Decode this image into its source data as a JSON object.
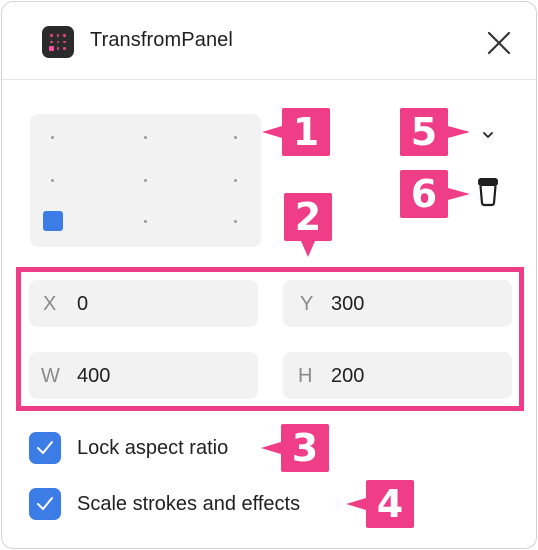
{
  "window": {
    "title": "TransfromPanel"
  },
  "fields": {
    "x": {
      "label": "X",
      "value": "0"
    },
    "y": {
      "label": "Y",
      "value": "300"
    },
    "w": {
      "label": "W",
      "value": "400"
    },
    "h": {
      "label": "H",
      "value": "200"
    }
  },
  "options": {
    "lock_aspect": {
      "label": "Lock aspect ratio",
      "checked": true
    },
    "scale_strokes": {
      "label": "Scale strokes and effects",
      "checked": true
    }
  },
  "annotations": [
    "1",
    "2",
    "3",
    "4",
    "5",
    "6"
  ],
  "anchor": {
    "selected": "bottom-left"
  },
  "colors": {
    "accent": "#3b7ce6",
    "annotation": "#ef3d87",
    "field_bg": "#f2f2f2"
  }
}
